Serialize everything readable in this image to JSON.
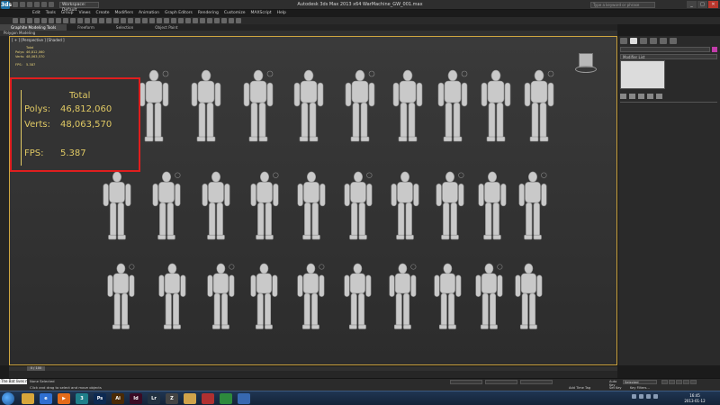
{
  "titlebar": {
    "app_logo": "3ds",
    "workspace": "Workspace: Default",
    "title": "Autodesk 3ds Max  2013 x64      WarMachine_GW_001.max",
    "search_placeholder": "Type a keyword or phrase",
    "min": "_",
    "max": "□",
    "close": "✕"
  },
  "menu": [
    "Edit",
    "Tools",
    "Group",
    "Views",
    "Create",
    "Modifiers",
    "Animation",
    "Graph Editors",
    "Rendering",
    "Customize",
    "MAXScript",
    "Help"
  ],
  "ribbon": {
    "tabs": [
      "Graphite Modeling Tools",
      "Freeform",
      "Selection",
      "Object Paint"
    ],
    "panel_label": "Polygon Modeling"
  },
  "viewport": {
    "label": "[ + ] [Perspective ] [Shaded ]",
    "stats": {
      "header": "Total",
      "polys_label": "Polys:",
      "polys": "46,812,060",
      "verts_label": "Verts:",
      "verts": "48,063,570",
      "fps_label": "FPS:",
      "fps": "5.387"
    },
    "figure_rows": [
      [
        160,
        218,
        276,
        332,
        389,
        442,
        492,
        540,
        588
      ],
      [
        120,
        175,
        230,
        284,
        336,
        388,
        440,
        490,
        537,
        582
      ],
      [
        125,
        182,
        236,
        284,
        336,
        388,
        438,
        488,
        534,
        578
      ]
    ]
  },
  "command_panel": {
    "modifier_list": "Modifier List",
    "colors": {
      "object_color": "#c23daa"
    }
  },
  "timeline": {
    "slider": "0 / 100"
  },
  "status": {
    "maxscript": "The Bat lives mo",
    "selection": "None Selected",
    "prompt": "Click and drag to select and move objects",
    "add_time_tag": "Add Time Tag",
    "auto_key": "Auto Key",
    "selected": "Selected",
    "set_key": "Set Key",
    "key_filters": "Key Filters..."
  },
  "taskbar": {
    "apps": [
      {
        "name": "explorer",
        "label": "",
        "color": "#d7a63a"
      },
      {
        "name": "ie",
        "label": "e",
        "color": "#2f6fd1"
      },
      {
        "name": "media",
        "label": "▶",
        "color": "#e36b1a"
      },
      {
        "name": "3dsmax",
        "label": "3",
        "color": "#1f7f8a"
      },
      {
        "name": "photoshop",
        "label": "Ps",
        "color": "#0d2a52"
      },
      {
        "name": "illustrator",
        "label": "Ai",
        "color": "#4a2a05"
      },
      {
        "name": "indesign",
        "label": "Id",
        "color": "#3b0b24"
      },
      {
        "name": "lightroom",
        "label": "Lr",
        "color": "#223140"
      },
      {
        "name": "zbrush",
        "label": "Z",
        "color": "#444"
      },
      {
        "name": "folder",
        "label": "",
        "color": "#d0a34a"
      },
      {
        "name": "app-red",
        "label": "",
        "color": "#b03030"
      },
      {
        "name": "app-green",
        "label": "",
        "color": "#2d8a3c"
      },
      {
        "name": "app-blue",
        "label": "",
        "color": "#3768b0"
      }
    ],
    "time": "16:45",
    "date": "2013-01-12"
  }
}
